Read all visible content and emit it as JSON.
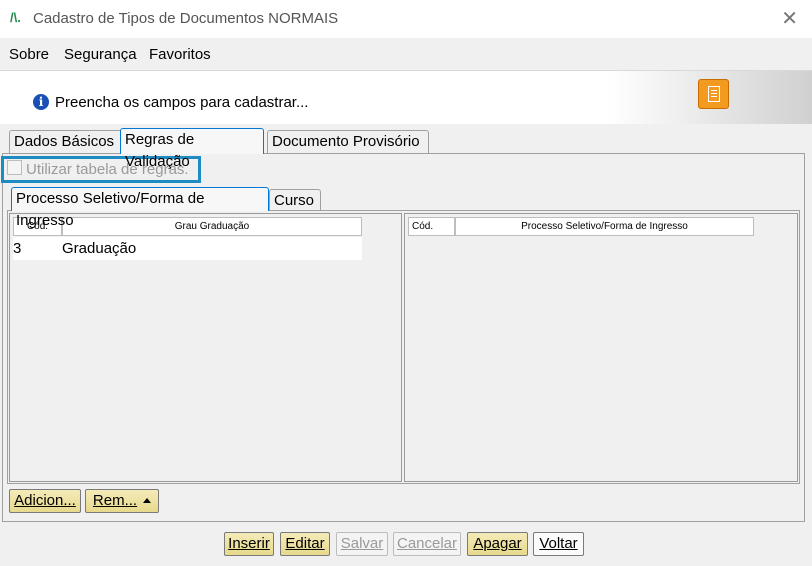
{
  "window": {
    "title": "Cadastro de Tipos de Documentos NORMAIS",
    "close": "✕",
    "logo": "/\\."
  },
  "menu": {
    "items": [
      "Sobre",
      "Segurança",
      "Favoritos"
    ]
  },
  "info": {
    "icon": "i",
    "text": "Preencha os campos para cadastrar..."
  },
  "tabs": [
    "Dados Básicos",
    "Regras de Validação",
    "Documento Provisório"
  ],
  "checkbox": {
    "label": "Utilizar tabela de regras.",
    "checked": false
  },
  "subtabs": [
    "Processo Seletivo/Forma de Ingresso",
    "Curso"
  ],
  "left_grid": {
    "headers": [
      "Cód.",
      "Grau Graduação"
    ],
    "rows": [
      {
        "cod": "3",
        "grau": "Graduação"
      }
    ]
  },
  "right_grid": {
    "headers": [
      "Cód.",
      "Processo Seletivo/Forma de Ingresso"
    ]
  },
  "grid_buttons": {
    "add": "Adicion...",
    "remove": "Rem..."
  },
  "actions": {
    "insert": "Inserir",
    "edit": "Editar",
    "save": "Salvar",
    "cancel": "Cancelar",
    "delete": "Apagar",
    "back": "Voltar"
  },
  "colors": {
    "highlight": "#1e8bc3",
    "button_yellow": "#e7d98c",
    "doc_button": "#f39a21"
  }
}
